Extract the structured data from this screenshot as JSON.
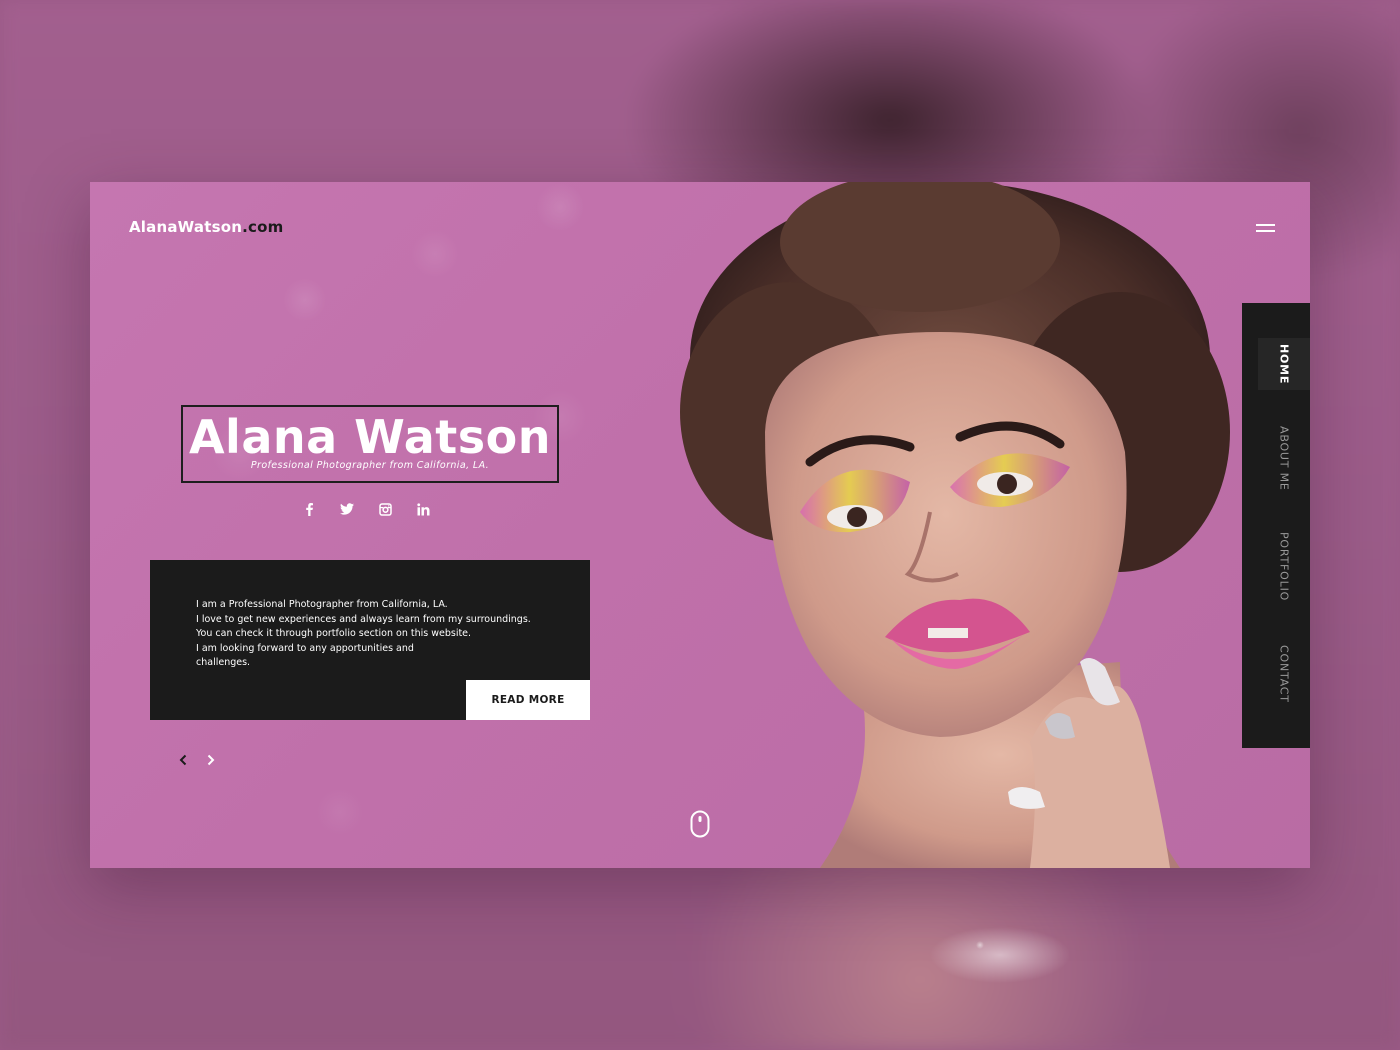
{
  "site": {
    "logo_main": "AlanaWatson",
    "logo_suffix": ".com"
  },
  "hero": {
    "name": "Alana Watson",
    "subtitle": "Professional Photographer from California, LA."
  },
  "socials": [
    {
      "icon": "facebook-icon"
    },
    {
      "icon": "twitter-icon"
    },
    {
      "icon": "instagram-icon"
    },
    {
      "icon": "linkedin-icon"
    }
  ],
  "about": {
    "lines": [
      "I am a Professional Photographer from California, LA.",
      "I love to get new experiences and always learn from my surroundings.",
      "You can check it through portfolio section on this website.",
      "I am looking forward to any apportunities and",
      "challenges."
    ],
    "button_label": "READ MORE"
  },
  "nav": {
    "items": [
      {
        "label": "HOME",
        "active": true
      },
      {
        "label": "ABOUT ME",
        "active": false
      },
      {
        "label": "PORTFOLIO",
        "active": false
      },
      {
        "label": "CONTACT",
        "active": false
      }
    ]
  },
  "colors": {
    "card_pink": "#c070aa",
    "panel_dark": "#1b1b1b",
    "text_white": "#ffffff",
    "nav_inactive": "#9a9a9a"
  }
}
